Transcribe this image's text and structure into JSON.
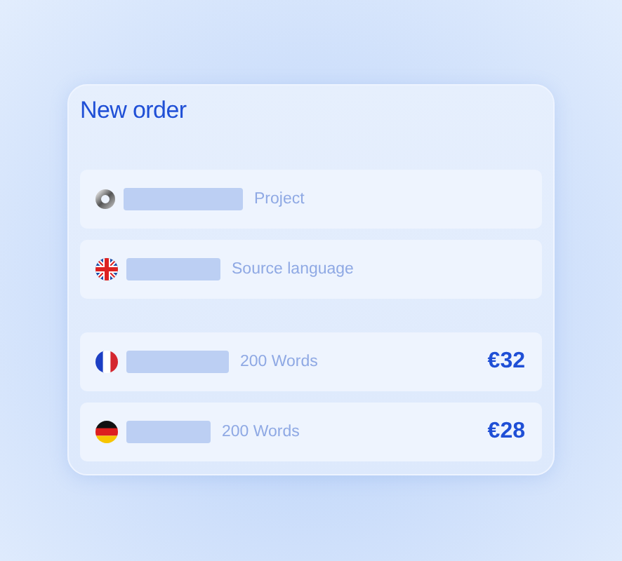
{
  "card": {
    "title": "New order"
  },
  "details": [
    {
      "kind": "project",
      "label": "Project"
    },
    {
      "kind": "uk",
      "label": "Source language"
    }
  ],
  "targets": [
    {
      "kind": "fr",
      "words": "200 Words",
      "price": "€32"
    },
    {
      "kind": "de",
      "words": "200 Words",
      "price": "€28"
    }
  ]
}
